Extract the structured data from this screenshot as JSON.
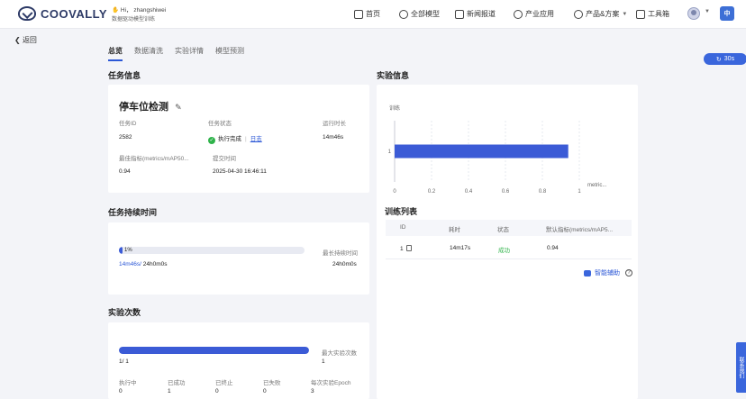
{
  "header": {
    "brand": "COOVALLY",
    "greeting_prefix": "Hi，",
    "user_name": "zhangshiwei",
    "subgreeting": "数据驱动模型训练",
    "nav": [
      {
        "label": "首页",
        "icon": "home-icon"
      },
      {
        "label": "全部模型",
        "icon": "model-icon"
      },
      {
        "label": "新闻报道",
        "icon": "news-icon"
      },
      {
        "label": "产业应用",
        "icon": "industry-icon"
      },
      {
        "label": "产品&方案",
        "icon": "product-icon"
      },
      {
        "label": "工具箱",
        "icon": "toolbox-icon"
      }
    ],
    "lang_label": "中"
  },
  "back_label": "返回",
  "tabs": [
    "总览",
    "数据清洗",
    "实验详情",
    "模型预测"
  ],
  "refresh_pill": "30s",
  "task_info": {
    "section_title": "任务信息",
    "name": "停车位检测",
    "task_id_label": "任务ID",
    "task_id": "2582",
    "status_label": "任务状态",
    "status": "执行完成",
    "log_link": "日志",
    "runtime_label": "运行时长",
    "runtime": "14m46s",
    "best_metric_label": "最佳指标(metrics/mAP50...",
    "best_metric": "0.94",
    "submit_time_label": "提交时间",
    "submit_time": "2025-04-30 16:46:11"
  },
  "duration": {
    "section_title": "任务持续时间",
    "percent_label": "1%",
    "percent": 0.01,
    "max_label": "最长持续时间",
    "elapsed": "14m46s/",
    "total": " 24h0m0s",
    "max_value": "24h0m0s"
  },
  "experiments": {
    "section_title": "实验次数",
    "progress": 1.0,
    "max_label": "最大实验次数",
    "count_label": "1/ 1",
    "max_value": "1",
    "stats": [
      {
        "label": "执行中",
        "value": "0"
      },
      {
        "label": "已成功",
        "value": "1"
      },
      {
        "label": "已终止",
        "value": "0"
      },
      {
        "label": "已失败",
        "value": "0"
      },
      {
        "label": "每次实验Epoch",
        "value": "3"
      }
    ]
  },
  "experiment_info": {
    "section_title": "实验信息"
  },
  "chart_data": {
    "type": "bar",
    "orientation": "horizontal",
    "categories": [
      "1"
    ],
    "values": [
      0.94
    ],
    "title": "",
    "ylabel": "训练",
    "xlabel": "metric...",
    "xlim": [
      0,
      1
    ],
    "x_ticks": [
      "0",
      "0.2",
      "0.4",
      "0.6",
      "0.8",
      "1"
    ],
    "bar_color": "#3b5bd6",
    "grid": true
  },
  "train_list": {
    "section_title": "训练列表",
    "columns": [
      "ID",
      "耗时",
      "状态",
      "默认指标(metrics/mAP5..."
    ],
    "rows": [
      {
        "id": "1",
        "duration": "14m17s",
        "status": "成功",
        "metric": "0.94"
      }
    ],
    "assist_label": "智能辅助",
    "status_color": "#2fb34a"
  },
  "side_tab_label": "联系我们"
}
